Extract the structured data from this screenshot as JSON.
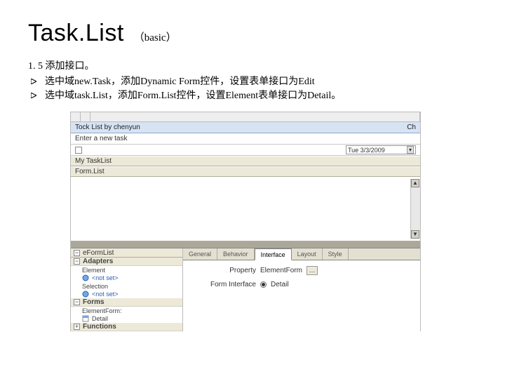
{
  "title": "Task.List",
  "subtitle": "（basic）",
  "section_heading": "1. 5 添加接口。",
  "bullets": [
    "选中域new.Task，添加Dynamic Form控件，设置表单接口为Edit",
    "选中域task.List，添加Form.List控件，设置Element表单接口为Detail。"
  ],
  "form": {
    "header_left": "Tock List by chenyun",
    "header_right": "Ch",
    "enter_label": "Enter a new task",
    "date_value": "Tue 3/3/2009",
    "grey_1": "My TaskList",
    "grey_2": "Form.List"
  },
  "tree": {
    "title": "eFormList",
    "cat_adapters": "Adapters",
    "leaf_element": "Element",
    "leaf_notset1": "<not set>",
    "leaf_selection": "Selection",
    "leaf_notset2": "<not set>",
    "cat_forms": "Forms",
    "leaf_elementform": "ElementForm:",
    "leaf_detail": "Detail",
    "cat_functions": "Functions"
  },
  "tabs": {
    "general": "General",
    "behavior": "Behavior",
    "interface": "Interface",
    "layout": "Layout",
    "style": "Style"
  },
  "props": {
    "label1": "Property",
    "val1": "ElementForm",
    "label2": "Form Interface",
    "val2": "Detail"
  }
}
